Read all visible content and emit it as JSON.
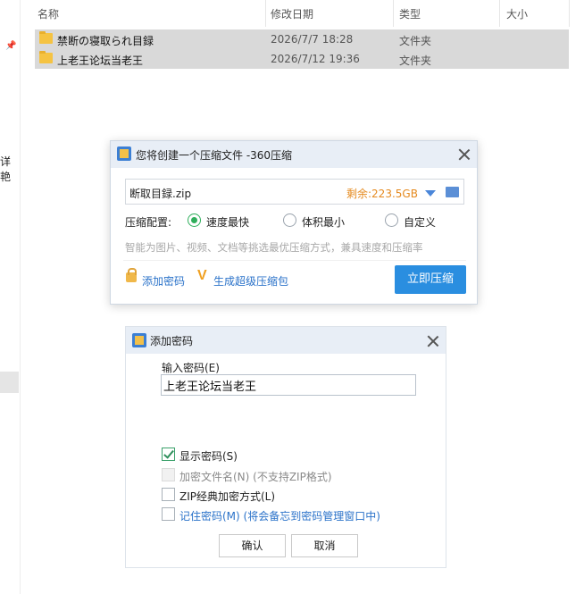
{
  "explorer": {
    "columns": {
      "name": "名称",
      "modified": "修改日期",
      "type": "类型",
      "size": "大小"
    },
    "side_text": "详艳",
    "rows": [
      {
        "name": "禁断の寝取られ目録",
        "modified": "2026/7/7 18:28",
        "type": "文件夹"
      },
      {
        "name": "上老王论坛当老王",
        "modified": "2026/7/12 19:36",
        "type": "文件夹"
      }
    ]
  },
  "compress_dialog": {
    "title": "您将创建一个压缩文件 -360压缩",
    "file_name": "断取目録.zip",
    "free_space": "剩余:223.5GB",
    "config_label": "压缩配置:",
    "options": [
      {
        "label": "速度最快",
        "selected": true
      },
      {
        "label": "体积最小",
        "selected": false
      },
      {
        "label": "自定义",
        "selected": false
      }
    ],
    "hint": "智能为图片、视频、文档等挑选最优压缩方式，兼具速度和压缩率",
    "add_password": "添加密码",
    "super_pack": "生成超级压缩包",
    "compress_button": "立即压缩"
  },
  "password_dialog": {
    "title": "添加密码",
    "input_label": "输入密码(E)",
    "password_value": "上老王论坛当老王",
    "checkboxes": [
      {
        "label": "显示密码(S)",
        "checked": true,
        "disabled": false
      },
      {
        "label": "加密文件名(N) (不支持ZIP格式)",
        "checked": false,
        "disabled": true
      },
      {
        "label": "ZIP经典加密方式(L)",
        "checked": false,
        "disabled": false
      },
      {
        "label": "记住密码(M) (将会备忘到密码管理窗口中)",
        "checked": false,
        "disabled": false
      }
    ],
    "ok_label": "确认",
    "cancel_label": "取消"
  }
}
